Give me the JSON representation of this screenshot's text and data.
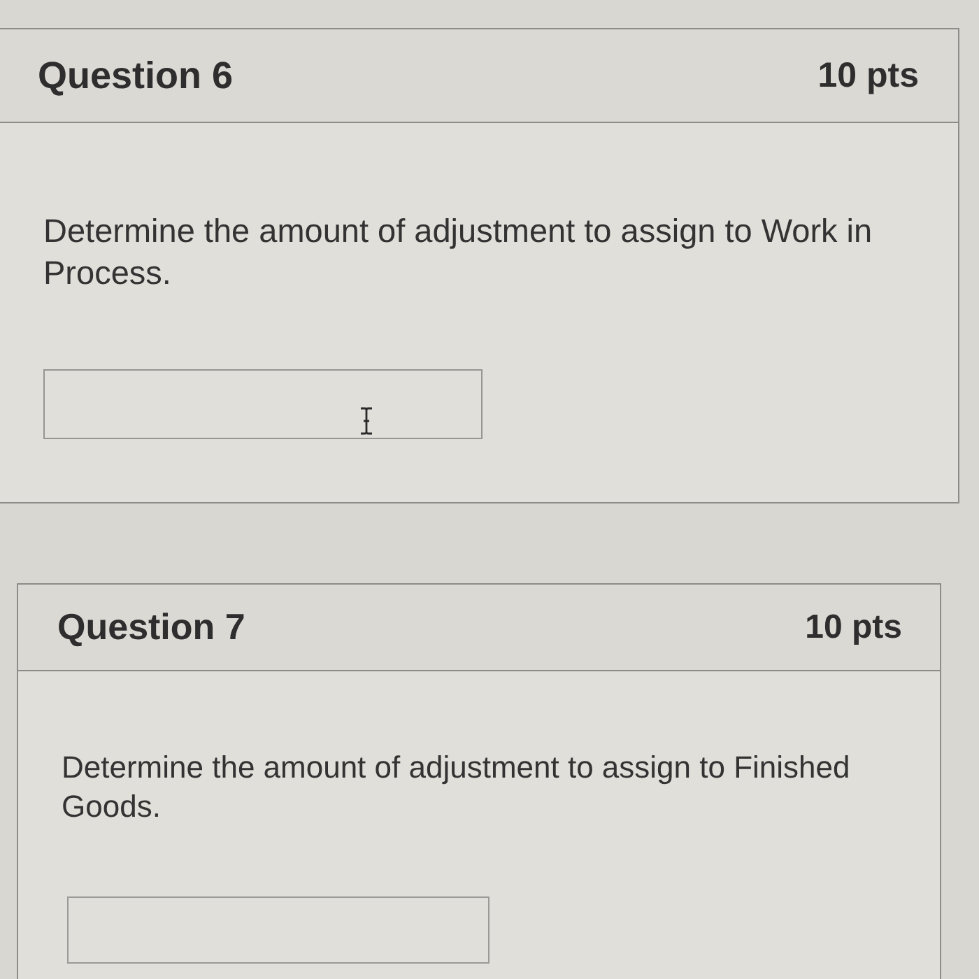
{
  "questions": [
    {
      "title": "Question 6",
      "points": "10 pts",
      "prompt": "Determine the amount of adjustment to assign to Work in Process.",
      "answer": {
        "hovered": true
      }
    },
    {
      "title": "Question 7",
      "points": "10 pts",
      "prompt": "Determine the amount of adjustment to assign to Finished Goods.",
      "answer": {
        "hovered": false
      }
    }
  ]
}
